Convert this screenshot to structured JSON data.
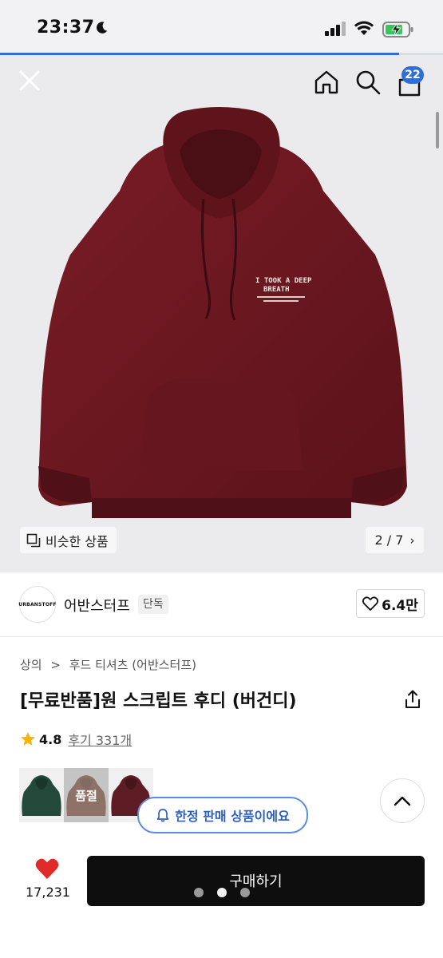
{
  "status_bar": {
    "time": "23:37"
  },
  "nav": {
    "cart_count": "22"
  },
  "page_progress": 0.9,
  "image": {
    "similar_label": "비슷한 상품",
    "counter": "2 / 7"
  },
  "brand": {
    "logo_text": "URBANSTOFF",
    "name": "어반스터프",
    "tag": "단독",
    "likes": "6.4만"
  },
  "breadcrumb": {
    "level1": "상의",
    "separator": ">",
    "level2": "후드 티셔츠 (어반스터프)"
  },
  "product": {
    "title": "[무료반품]원 스크립트 후디 (버건디)",
    "rating": "4.8",
    "review_link": "후기 331개",
    "print_lines": [
      "I TOOK A DEEP",
      "BREATH"
    ]
  },
  "color_options": [
    {
      "color": "#23493a",
      "sold_out": false,
      "label": ""
    },
    {
      "color": "#7a3a22",
      "sold_out": true,
      "label": "품절"
    },
    {
      "color": "#5e1d24",
      "sold_out": false,
      "label": ""
    }
  ],
  "notice": {
    "limited_label": "한정 판매 상품이에요"
  },
  "bottom": {
    "wish_count": "17,231",
    "buy_label": "구매하기"
  },
  "colors": {
    "accent": "#2f6ed9",
    "burgundy": "#6b1620",
    "buy_button": "#0e0e0e",
    "heart": "#e02a2a"
  }
}
